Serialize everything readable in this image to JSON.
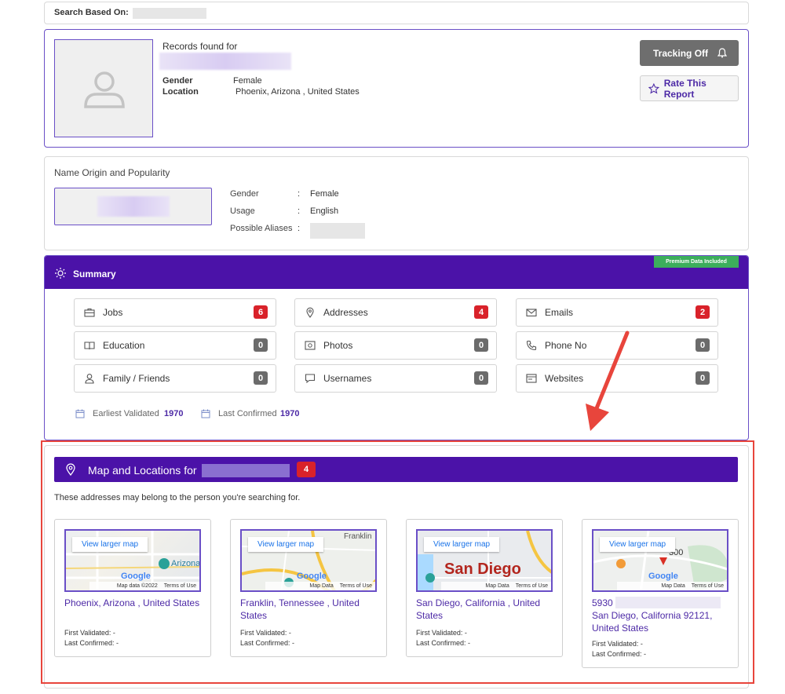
{
  "search": {
    "label": "Search Based On:"
  },
  "profile": {
    "records_label": "Records found for",
    "gender_label": "Gender",
    "gender_value": "Female",
    "location_label": "Location",
    "location_value": "Phoenix, Arizona , United States",
    "tracking_button": "Tracking Off",
    "rate_button": "Rate This Report"
  },
  "name_origin": {
    "title": "Name Origin and Popularity",
    "rows": [
      {
        "label": "Gender",
        "sep": ":",
        "value": "Female"
      },
      {
        "label": "Usage",
        "sep": ":",
        "value": "English"
      },
      {
        "label": "Possible Aliases",
        "sep": ":",
        "value": ""
      }
    ]
  },
  "summary": {
    "title": "Summary",
    "premium_badge": "Premium Data Included",
    "items": [
      {
        "label": "Jobs",
        "count": "6",
        "icon": "briefcase-icon",
        "highlight": true
      },
      {
        "label": "Addresses",
        "count": "4",
        "icon": "map-pin-icon",
        "highlight": true
      },
      {
        "label": "Emails",
        "count": "2",
        "icon": "mail-icon",
        "highlight": true
      },
      {
        "label": "Education",
        "count": "0",
        "icon": "book-icon",
        "highlight": false
      },
      {
        "label": "Photos",
        "count": "0",
        "icon": "photo-icon",
        "highlight": false
      },
      {
        "label": "Phone No",
        "count": "0",
        "icon": "phone-icon",
        "highlight": false
      },
      {
        "label": "Family / Friends",
        "count": "0",
        "icon": "person-icon",
        "highlight": false
      },
      {
        "label": "Usernames",
        "count": "0",
        "icon": "chat-icon",
        "highlight": false
      },
      {
        "label": "Websites",
        "count": "0",
        "icon": "browser-icon",
        "highlight": false
      }
    ],
    "earliest_label": "Earliest Validated",
    "earliest_value": "1970",
    "last_label": "Last Confirmed",
    "last_value": "1970"
  },
  "locations": {
    "title": "Map and Locations for",
    "count": "4",
    "subtitle": "These addresses may belong to the person you're searching for.",
    "view_larger_map": "View larger map",
    "cards": [
      {
        "map_label": "Arizona",
        "map_footer": "Map data ©2022",
        "terms": "Terms of Use",
        "address": "Phoenix, Arizona , United States",
        "first_validated": "First Validated: -",
        "last_confirmed": "Last Confirmed: -"
      },
      {
        "map_label": "Franklin",
        "map_footer": "Map Data",
        "terms": "Terms of Use",
        "address": "Franklin, Tennessee , United States",
        "first_validated": "First Validated: -",
        "last_confirmed": "Last Confirmed: -"
      },
      {
        "map_label": "San Diego",
        "map_footer": "Map Data",
        "terms": "Terms of Use",
        "address": "San Diego, California , United States",
        "first_validated": "First Validated: -",
        "last_confirmed": "Last Confirmed: -"
      },
      {
        "map_label": "300",
        "map_footer": "Map Data",
        "terms": "Terms of Use",
        "address_line1": "5930",
        "address": "San Diego, California 92121, United States",
        "first_validated": "First Validated: -",
        "last_confirmed": "Last Confirmed: -"
      }
    ]
  },
  "colors": {
    "brand_purple": "#4b12a8",
    "badge_red": "#d9222a",
    "annotation_red": "#e8453c",
    "premium_green": "#3cae5c"
  }
}
